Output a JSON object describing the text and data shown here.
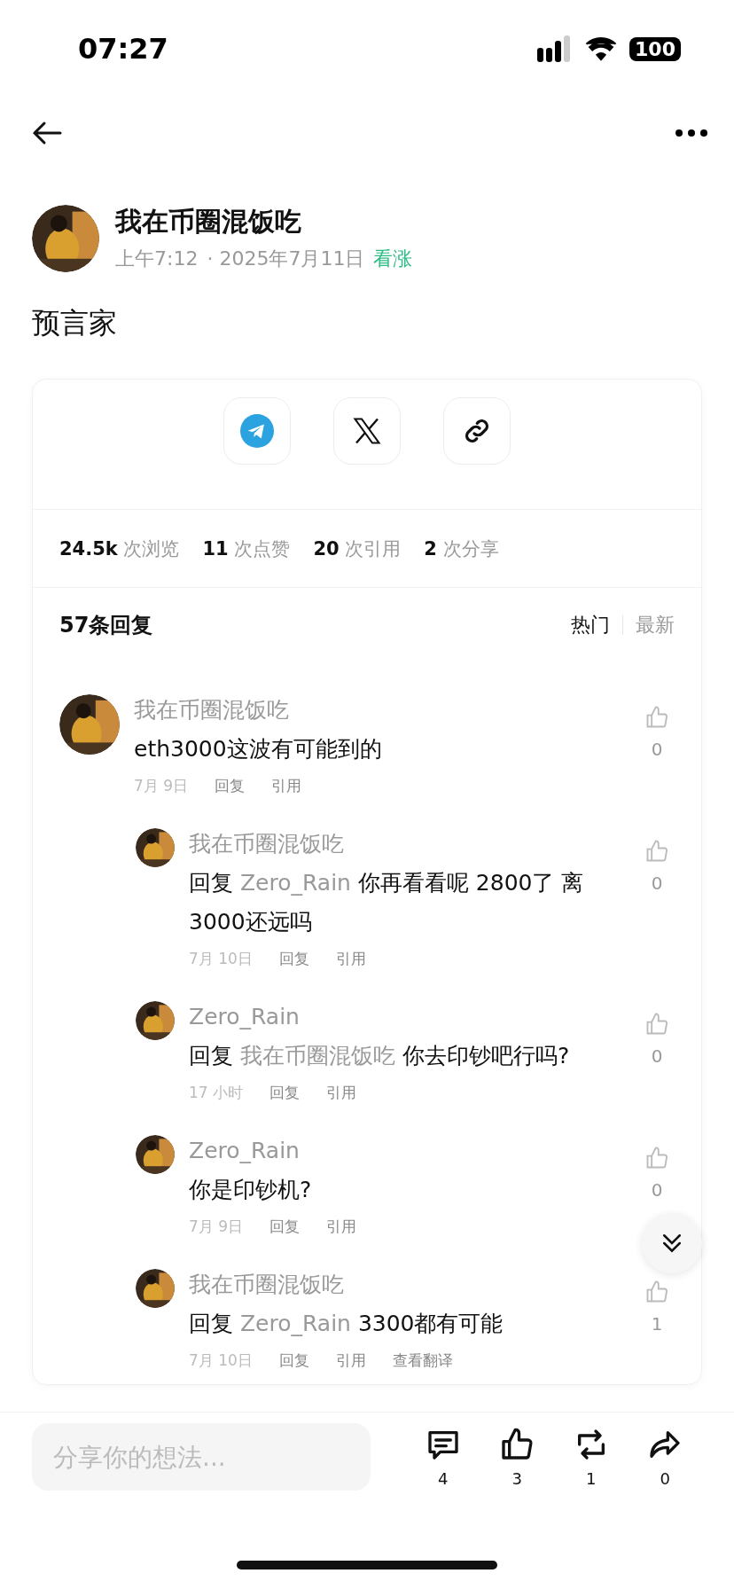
{
  "status_bar": {
    "time": "07:27",
    "battery": "100"
  },
  "post": {
    "author": "我在币圈混饭吃",
    "time": "上午7:12",
    "date": "· 2025年7月11日",
    "sentiment": "看涨",
    "text": "预言家"
  },
  "share_buttons": [
    {
      "kind": "telegram"
    },
    {
      "kind": "x"
    },
    {
      "kind": "link"
    }
  ],
  "stats": [
    "**24.5k** 次浏览",
    "**11** 次点赞",
    "**20** 次引用",
    "**2** 次分享"
  ],
  "replies": {
    "title": "57条回复",
    "sort_tabs": [
      {
        "label": "热门",
        "selected": true
      },
      {
        "label": "最新",
        "selected": false
      }
    ]
  },
  "comments": [
    {
      "author": "我在币圈混饭吃",
      "text": "eth3000这波有可能到的",
      "date": "7月 9日",
      "actions": [
        "回复",
        "引用"
      ],
      "likes": "0",
      "children": [
        {
          "author": "我在币圈混饭吃",
          "reply_prefix": "回复",
          "mention": "Zero_Rain",
          "text": "你再看看呢 2800了 离3000还远吗",
          "date": "7月 10日",
          "actions": [
            "回复",
            "引用"
          ],
          "likes": "0"
        },
        {
          "author": "Zero_Rain",
          "reply_prefix": "回复",
          "mention": "我在币圈混饭吃",
          "text": "你去印钞吧行吗?",
          "date": "17 小时",
          "actions": [
            "回复",
            "引用"
          ],
          "likes": "0"
        },
        {
          "author": "Zero_Rain",
          "text": "你是印钞机?",
          "date": "7月 9日",
          "actions": [
            "回复",
            "引用"
          ],
          "likes": "0"
        },
        {
          "author": "我在币圈混饭吃",
          "reply_prefix": "回复",
          "mention": "Zero_Rain",
          "text": "3300都有可能",
          "date": "7月 10日",
          "actions": [
            "回复",
            "引用",
            "查看翻译"
          ],
          "likes": "1"
        }
      ]
    }
  ],
  "composer": {
    "placeholder": "分享你的想法..."
  },
  "action_bar": [
    {
      "kind": "comment",
      "count": "4"
    },
    {
      "kind": "like",
      "count": "3"
    },
    {
      "kind": "repost",
      "count": "1"
    },
    {
      "kind": "share",
      "count": "0"
    }
  ]
}
